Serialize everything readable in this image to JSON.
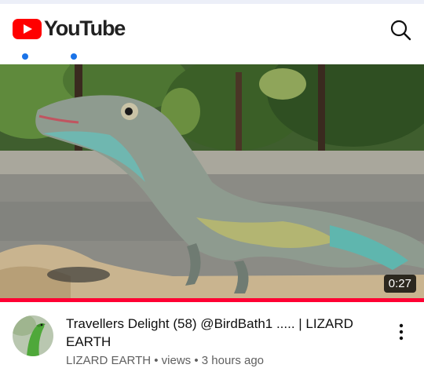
{
  "app": {
    "name": "YouTube",
    "brand_red": "#ff0000",
    "accent_blue": "#1a73e8"
  },
  "header": {
    "logo_icon": "youtube-play-icon",
    "search_icon": "search-icon"
  },
  "video": {
    "duration": "0:27",
    "progress_fraction": 1.0,
    "thumbnail": "green anole lizard on a concrete ledge"
  },
  "details": {
    "title": "Travellers Delight (58) @BirdBath1 ..... | LIZARD EARTH",
    "channel": "LIZARD EARTH",
    "separator1": " • ",
    "views": "views",
    "separator2": " • ",
    "age": "3 hours ago",
    "menu_icon": "more-vertical-icon"
  }
}
